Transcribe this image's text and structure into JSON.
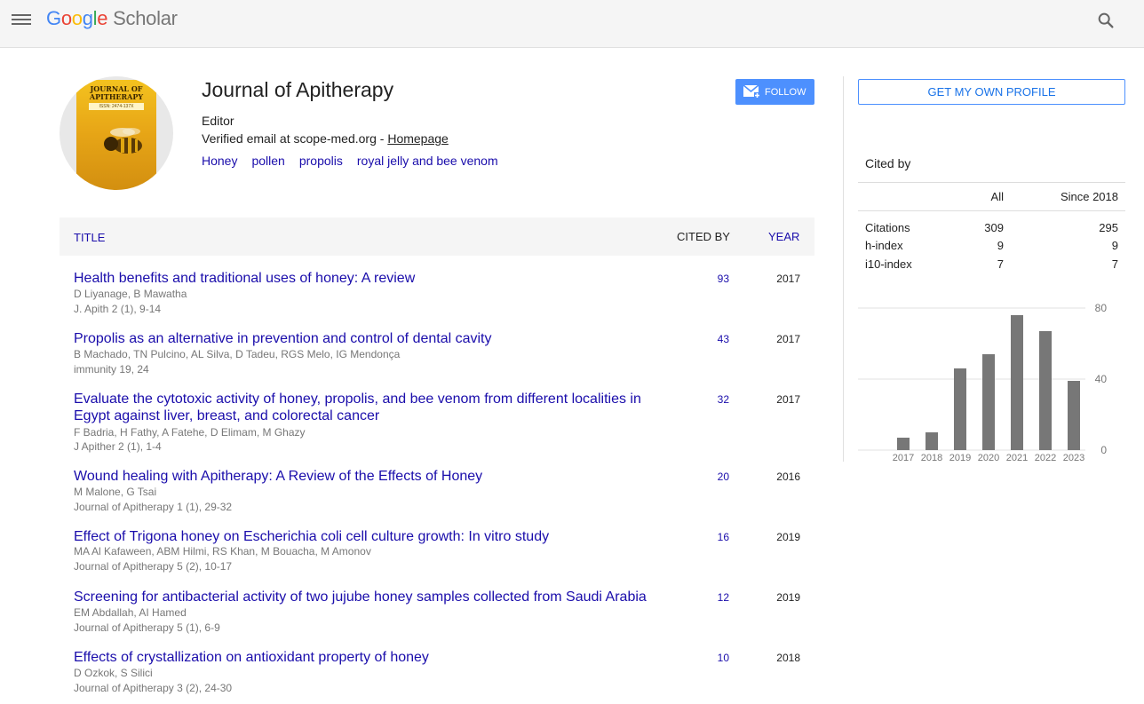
{
  "header": {
    "logo_google": "Google",
    "logo_scholar": "Scholar"
  },
  "profile": {
    "name": "Journal of Apitherapy",
    "affiliation": "Editor",
    "email_text": "Verified email at scope-med.org - ",
    "homepage_link": "Homepage",
    "interests": [
      "Honey",
      "pollen",
      "propolis",
      "royal jelly and bee venom"
    ],
    "follow_label": "FOLLOW",
    "cover_title_1": "JOURNAL OF",
    "cover_title_2": "APITHERAPY",
    "cover_issn": "ISSN: 2474-137X"
  },
  "table": {
    "col_title": "TITLE",
    "col_cited": "CITED BY",
    "col_year": "YEAR",
    "rows": [
      {
        "title": "Health benefits and traditional uses of honey: A review",
        "authors": "D Liyanage, B Mawatha",
        "source": "J. Apith 2 (1), 9-14",
        "cited": "93",
        "year": "2017"
      },
      {
        "title": "Propolis as an alternative in prevention and control of dental cavity",
        "authors": "B Machado, TN Pulcino, AL Silva, D Tadeu, RGS Melo, IG Mendonça",
        "source": "immunity 19, 24",
        "cited": "43",
        "year": "2017"
      },
      {
        "title": "Evaluate the cytotoxic activity of honey, propolis, and bee venom from different localities in Egypt against liver, breast, and colorectal cancer",
        "authors": "F Badria, H Fathy, A Fatehe, D Elimam, M Ghazy",
        "source": "J Apither 2 (1), 1-4",
        "cited": "32",
        "year": "2017"
      },
      {
        "title": "Wound healing with Apitherapy: A Review of the Effects of Honey",
        "authors": "M Malone, G Tsai",
        "source": "Journal of Apitherapy 1 (1), 29-32",
        "cited": "20",
        "year": "2016"
      },
      {
        "title": "Effect of Trigona honey on Escherichia coli cell culture growth: In vitro study",
        "authors": "MA Al Kafaween, ABM Hilmi, RS Khan, M Bouacha, M Amonov",
        "source": "Journal of Apitherapy 5 (2), 10-17",
        "cited": "16",
        "year": "2019"
      },
      {
        "title": "Screening for antibacterial activity of two jujube honey samples collected from Saudi Arabia",
        "authors": "EM Abdallah, AI Hamed",
        "source": "Journal of Apitherapy 5 (1), 6-9",
        "cited": "12",
        "year": "2019"
      },
      {
        "title": "Effects of crystallization on antioxidant property of honey",
        "authors": "D Ozkok, S Silici",
        "source": "Journal of Apitherapy 3 (2), 24-30",
        "cited": "10",
        "year": "2018"
      }
    ]
  },
  "sidebar": {
    "get_profile_label": "GET MY OWN PROFILE",
    "cited_by": "Cited by",
    "col_all": "All",
    "col_since": "Since 2018",
    "metrics": [
      {
        "name": "Citations",
        "all": "309",
        "since": "295"
      },
      {
        "name": "h-index",
        "all": "9",
        "since": "9"
      },
      {
        "name": "i10-index",
        "all": "7",
        "since": "7"
      }
    ]
  },
  "chart_data": {
    "type": "bar",
    "categories": [
      "2017",
      "2018",
      "2019",
      "2020",
      "2021",
      "2022",
      "2023"
    ],
    "values": [
      7,
      10,
      46,
      54,
      76,
      67,
      39
    ],
    "yticks": [
      "0",
      "40",
      "80"
    ],
    "ylim": [
      0,
      80
    ],
    "bar_color": "#777777"
  }
}
